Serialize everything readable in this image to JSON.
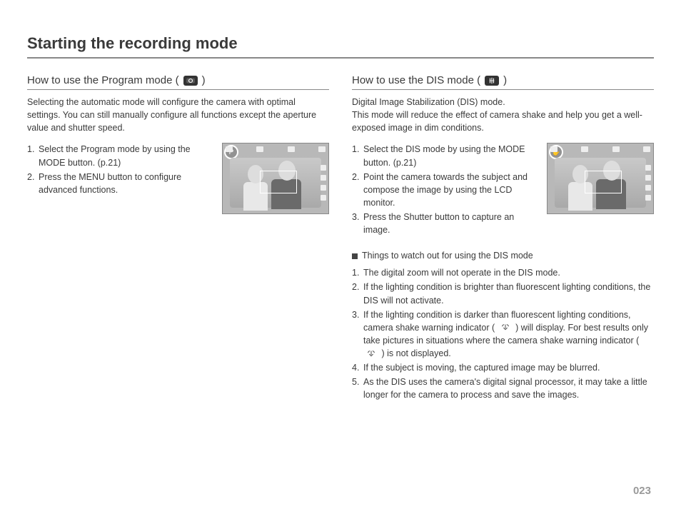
{
  "page": {
    "title": "Starting the recording mode",
    "number": "023"
  },
  "left": {
    "heading_pre": "How to use the Program mode (",
    "heading_post": ")",
    "icon_label": "program-mode-icon",
    "intro": "Selecting the automatic mode will configure the camera with optimal settings. You can still manually configure all functions except the aperture value and shutter speed.",
    "steps": [
      "Select the Program mode by using the MODE button. (p.21)",
      "Press the MENU button to configure advanced functions."
    ],
    "thumb_corner": "P"
  },
  "right": {
    "heading_pre": "How to use the DIS mode (",
    "heading_post": ")",
    "icon_label": "dis-mode-icon",
    "intro": "Digital Image Stabilization (DIS) mode.\nThis mode will reduce the effect of camera shake and help you get a well-exposed image in dim conditions.",
    "steps": [
      "Select the DIS mode by using the MODE button. (p.21)",
      "Point the camera towards the subject and compose the image by using the LCD monitor.",
      "Press the Shutter button to capture an image."
    ],
    "thumb_corner": "✋",
    "watch_heading": "Things to watch out for using the DIS mode",
    "watch": [
      "The digital zoom will not operate in the DIS mode.",
      "If the lighting condition is brighter than fluorescent lighting conditions, the DIS will not activate.",
      {
        "pre": "If the lighting condition is darker than fluorescent lighting conditions, camera shake warning indicator (",
        "mid": ") will display. For best results only take pictures in situations where the camera shake warning indicator (",
        "post": ") is not displayed."
      },
      "If the subject is moving, the captured image may be blurred.",
      "As the DIS uses the camera's digital signal processor, it may take a little longer for the camera to process and save the images."
    ]
  }
}
